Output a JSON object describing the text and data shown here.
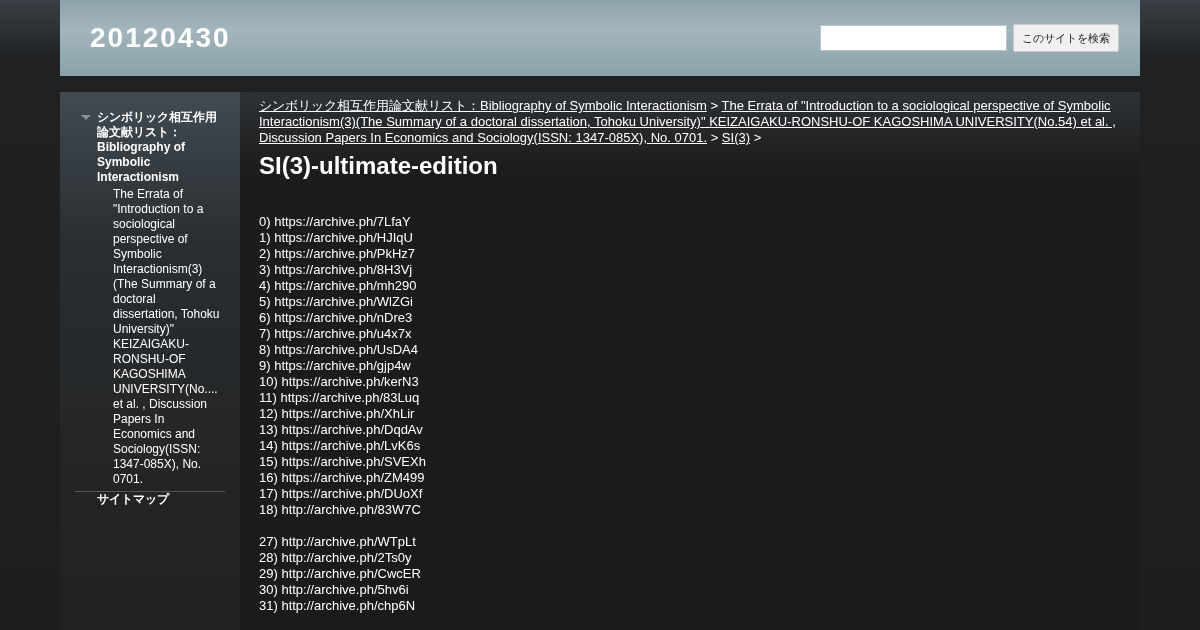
{
  "site_title": "20120430",
  "search": {
    "button": "このサイトを検索"
  },
  "sidebar": {
    "items": [
      {
        "label": "シンボリック相互作用論文献リスト：Bibliography of Symbolic Interactionism",
        "expanded": true,
        "children": [
          {
            "label": "The Errata of \"Introduction to a sociological perspective of Symbolic Interactionism(3)(The Summary of a doctoral dissertation, Tohoku University)\" KEIZAIGAKU-RONSHU-OF KAGOSHIMA UNIVERSITY(No.... et al. , Discussion Papers In Economics and Sociology(ISSN: 1347-085X), No. 0701."
          }
        ]
      },
      {
        "label": "サイトマップ"
      }
    ]
  },
  "breadcrumbs": {
    "separator": ">",
    "items": [
      "シンボリック相互作用論文献リスト：Bibliography of Symbolic Interactionism",
      "The Errata of \"Introduction to a sociological perspective of Symbolic Interactionism(3)(The Summary of a doctoral dissertation, Tohoku University)\" KEIZAIGAKU-RONSHU-OF KAGOSHIMA UNIVERSITY(No.54) et al. , Discussion Papers In Economics and Sociology(ISSN: 1347-085X), No. 0701.",
      "SI(3)"
    ]
  },
  "page_title": "SI(3)-ultimate-edition",
  "link_groups": [
    [
      "0) https://archive.ph/7LfaY",
      "1) https://archive.ph/HJIqU",
      "2) https://archive.ph/PkHz7",
      "3) https://archive.ph/8H3Vj",
      "4) https://archive.ph/mh290",
      "5) https://archive.ph/WlZGi",
      "6) https://archive.ph/nDre3",
      "7) https://archive.ph/u4x7x",
      "8) https://archive.ph/UsDA4",
      "9) https://archive.ph/gjp4w",
      "10) https://archive.ph/kerN3",
      "11) https://archive.ph/83Luq",
      "12) https://archive.ph/XhLir",
      "13) https://archive.ph/DqdAv",
      "14) https://archive.ph/LvK6s",
      "15) https://archive.ph/SVEXh",
      "16) https://archive.ph/ZM499",
      "17) https://archive.ph/DUoXf",
      "18) http://archive.ph/83W7C"
    ],
    [
      "27) http://archive.ph/WTpLt",
      "28) http://archive.ph/2Ts0y",
      "29) http://archive.ph/CwcER",
      "30) http://archive.ph/5hv6i",
      "31) http://archive.ph/chp6N"
    ]
  ]
}
